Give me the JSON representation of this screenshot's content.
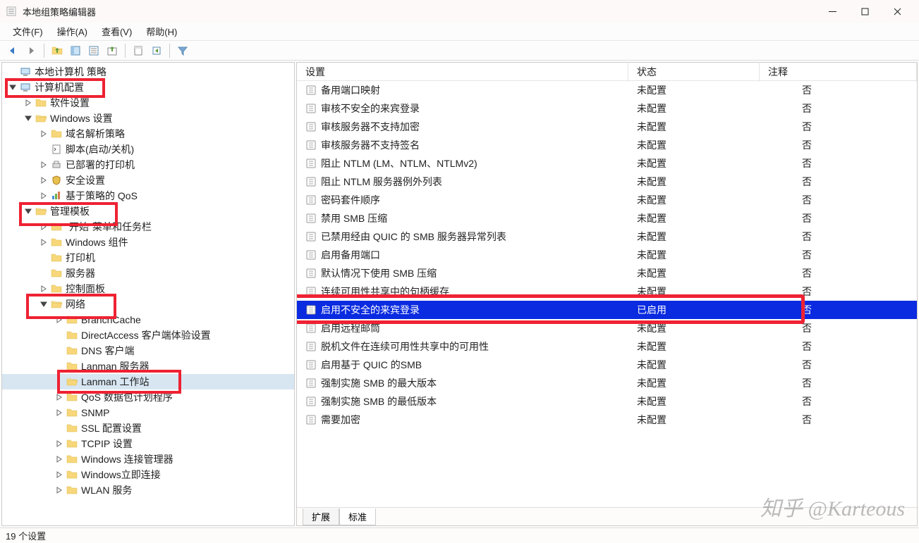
{
  "window": {
    "title": "本地组策略编辑器"
  },
  "menu": {
    "file": "文件(F)",
    "action": "操作(A)",
    "view": "查看(V)",
    "help": "帮助(H)"
  },
  "tree": {
    "root_cut": "本地计算机 策略",
    "computer_config": "计算机配置",
    "software_cut": "软件设置",
    "windows_settings": "Windows 设置",
    "dns_policy": "域名解析策略",
    "scripts": "脚本(启动/关机)",
    "deployed_printers": "已部署的打印机",
    "security": "安全设置",
    "qos": "基于策略的 QoS",
    "admin_templates": "管理模板",
    "start_taskbar": "\"开始\"菜单和任务栏",
    "win_components": "Windows 组件",
    "printers": "打印机",
    "server": "服务器",
    "control_panel": "控制面板",
    "network": "网络",
    "branchcache": "BranchCache",
    "directaccess": "DirectAccess 客户端体验设置",
    "dns_client": "DNS 客户端",
    "lanman_server": "Lanman 服务器",
    "lanman_workstation": "Lanman 工作站",
    "qos_packet": "QoS 数据包计划程序",
    "snmp": "SNMP",
    "ssl_config": "SSL 配置设置",
    "tcpip": "TCPIP 设置",
    "win_conn_mgr": "Windows 连接管理器",
    "win_instant": "Windows立即连接",
    "wlan": "WLAN 服务"
  },
  "list": {
    "header": {
      "setting": "设置",
      "state": "状态",
      "note": "注释"
    },
    "rows": [
      {
        "setting": "备用端口映射",
        "state": "未配置",
        "note": "否"
      },
      {
        "setting": "审核不安全的来宾登录",
        "state": "未配置",
        "note": "否"
      },
      {
        "setting": "审核服务器不支持加密",
        "state": "未配置",
        "note": "否"
      },
      {
        "setting": "审核服务器不支持签名",
        "state": "未配置",
        "note": "否"
      },
      {
        "setting": "阻止 NTLM (LM、NTLM、NTLMv2)",
        "state": "未配置",
        "note": "否"
      },
      {
        "setting": "阻止 NTLM 服务器例外列表",
        "state": "未配置",
        "note": "否"
      },
      {
        "setting": "密码套件顺序",
        "state": "未配置",
        "note": "否"
      },
      {
        "setting": "禁用 SMB 压缩",
        "state": "未配置",
        "note": "否"
      },
      {
        "setting": "已禁用经由 QUIC 的 SMB 服务器异常列表",
        "state": "未配置",
        "note": "否"
      },
      {
        "setting": "启用备用端口",
        "state": "未配置",
        "note": "否"
      },
      {
        "setting": "默认情况下使用 SMB 压缩",
        "state": "未配置",
        "note": "否"
      },
      {
        "setting": "连续可用性共享中的句柄缓存",
        "state": "未配置",
        "note": "否"
      },
      {
        "setting": "启用不安全的来宾登录",
        "state": "已启用",
        "note": "否",
        "selected": true
      },
      {
        "setting": "启用远程邮筒",
        "state": "未配置",
        "note": "否"
      },
      {
        "setting": "脱机文件在连续可用性共享中的可用性",
        "state": "未配置",
        "note": "否"
      },
      {
        "setting": "启用基于 QUIC 的SMB",
        "state": "未配置",
        "note": "否"
      },
      {
        "setting": "强制实施 SMB 的最大版本",
        "state": "未配置",
        "note": "否"
      },
      {
        "setting": "强制实施 SMB 的最低版本",
        "state": "未配置",
        "note": "否"
      },
      {
        "setting": "需要加密",
        "state": "未配置",
        "note": "否"
      }
    ]
  },
  "tabs": {
    "extended": "扩展",
    "standard": "标准"
  },
  "status": "19 个设置",
  "watermark": "知乎 @Karteous"
}
